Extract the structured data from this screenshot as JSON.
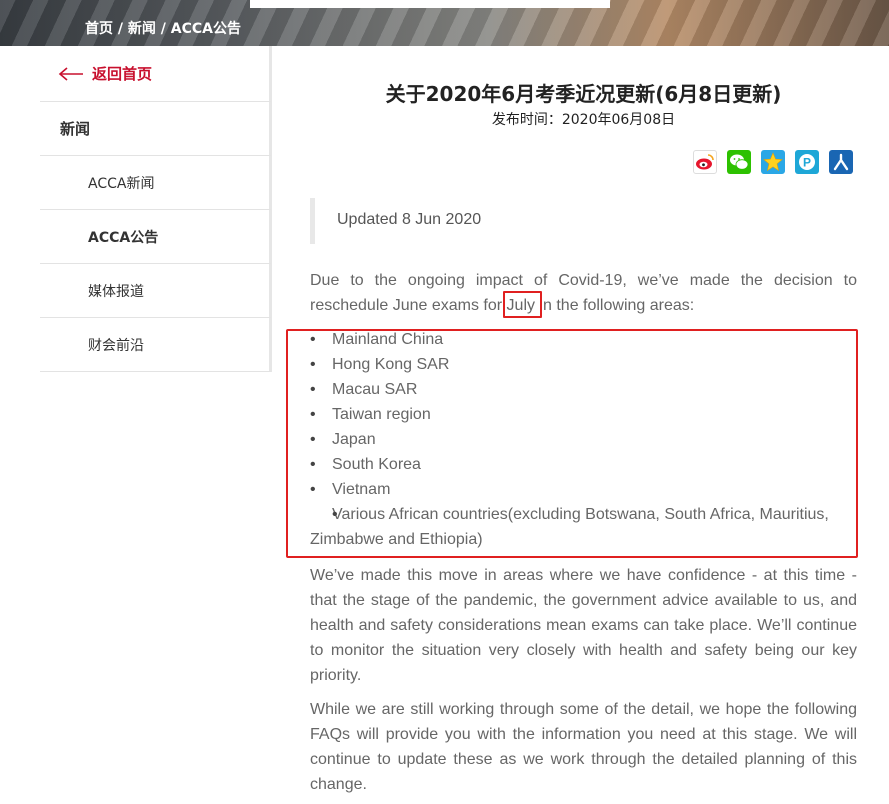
{
  "breadcrumb": {
    "home": "首页",
    "sep1": " / ",
    "news": "新闻",
    "sep2": " / ",
    "current": "ACCA公告"
  },
  "sidebar": {
    "back_label": "返回首页",
    "heading": "新闻",
    "items": [
      {
        "label": "ACCA新闻"
      },
      {
        "label": "ACCA公告"
      },
      {
        "label": "媒体报道"
      },
      {
        "label": "财会前沿"
      }
    ]
  },
  "article": {
    "title": "关于2020年6月考季近况更新(6月8日更新)",
    "pub_date": "发布时间：2020年06月08日",
    "share_icons": [
      "weibo-icon",
      "wechat-icon",
      "qzone-icon",
      "pinyou-icon",
      "renren-icon"
    ],
    "updated": "Updated 8 Jun 2020",
    "intro_before": "Due to the ongoing impact of Covid-19, we’ve made the decision to reschedule June exams for ",
    "intro_highlight": "July",
    "intro_after": " in the following areas:",
    "areas": [
      "Mainland China",
      "Hong Kong SAR",
      "Macau SAR",
      "Taiwan region",
      "Japan",
      "South Korea",
      "Vietnam",
      "Various African countries(excluding Botswana, South Africa, Mauritius, Zimbabwe and Ethiopia)"
    ],
    "para2": "We’ve made this move in areas where we have confidence - at this time - that the stage of the pandemic, the government advice available to us, and health and safety considerations mean exams can take place. We’ll continue to monitor the situation very closely with health and safety being our key priority.",
    "para3": "While we are still working through some of the detail, we hope the following FAQs will provide you with the information you need at this stage. We will continue to update these as we work through the detailed planning of this change."
  },
  "colors": {
    "accent": "#c8102e",
    "highlight_box": "#e02020"
  }
}
